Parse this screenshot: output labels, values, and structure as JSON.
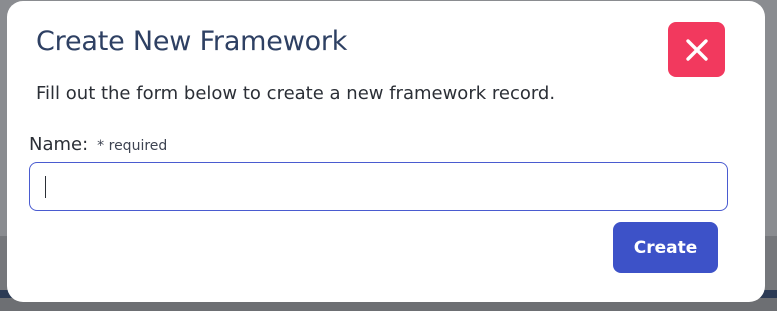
{
  "modal": {
    "title": "Create New Framework",
    "description": "Fill out the form below to create a new framework record.",
    "close_icon": "close-x-icon"
  },
  "form": {
    "name_label": "Name:",
    "required_note": "* required",
    "name_value": "",
    "name_placeholder": "",
    "submit_label": "Create"
  },
  "colors": {
    "title": "#2e4063",
    "close_button": "#f2395e",
    "primary_button": "#3d52c8",
    "input_border_focus": "#4a5bd0",
    "backdrop": "#8a8c90"
  }
}
